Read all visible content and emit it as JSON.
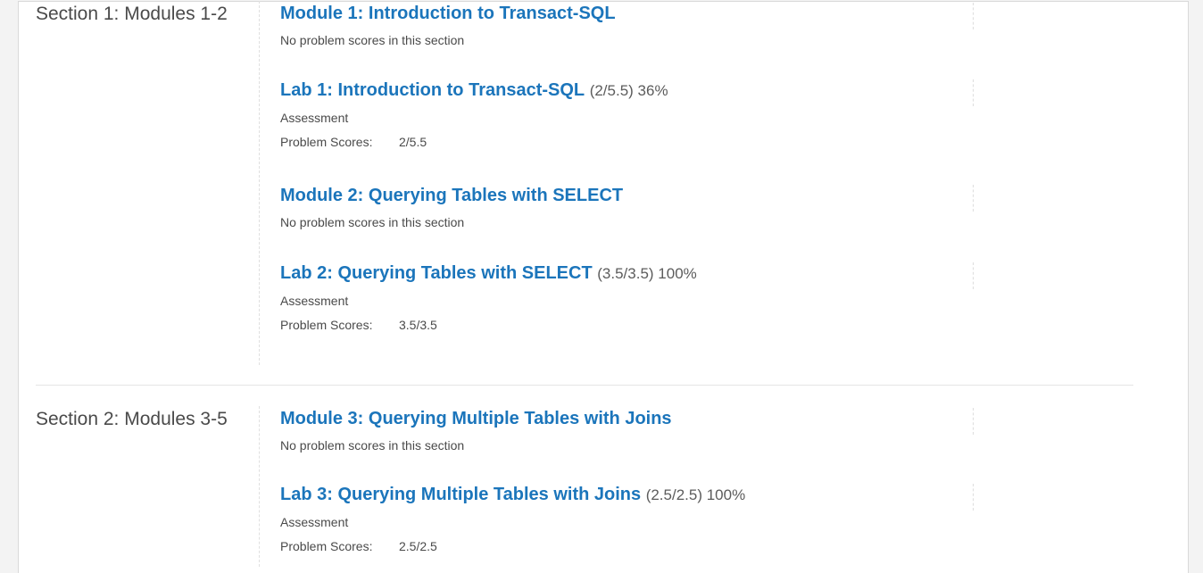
{
  "chapters": [
    {
      "title": "Section 1: Modules 1-2",
      "sections": [
        {
          "title": "Module 1: Introduction to Transact-SQL",
          "score": "",
          "subtitle": "No problem scores in this section",
          "problem_scores_label": "",
          "problem_scores_value": ""
        },
        {
          "title": "Lab 1: Introduction to Transact-SQL",
          "score": "(2/5.5) 36%",
          "subtitle": "Assessment",
          "problem_scores_label": "Problem Scores:",
          "problem_scores_value": "2/5.5"
        },
        {
          "title": "Module 2: Querying Tables with SELECT",
          "score": "",
          "subtitle": "No problem scores in this section",
          "problem_scores_label": "",
          "problem_scores_value": ""
        },
        {
          "title": "Lab 2: Querying Tables with SELECT",
          "score": "(3.5/3.5) 100%",
          "subtitle": "Assessment",
          "problem_scores_label": "Problem Scores:",
          "problem_scores_value": "3.5/3.5"
        }
      ]
    },
    {
      "title": "Section 2: Modules 3-5",
      "sections": [
        {
          "title": "Module 3: Querying Multiple Tables with Joins",
          "score": "",
          "subtitle": "No problem scores in this section",
          "problem_scores_label": "",
          "problem_scores_value": ""
        },
        {
          "title": "Lab 3: Querying Multiple Tables with Joins",
          "score": "(2.5/2.5) 100%",
          "subtitle": "Assessment",
          "problem_scores_label": "Problem Scores:",
          "problem_scores_value": "2.5/2.5"
        }
      ]
    }
  ],
  "colors": {
    "link": "#1b75bb",
    "text": "#4a4a4a",
    "score": "#5c5c5c"
  }
}
